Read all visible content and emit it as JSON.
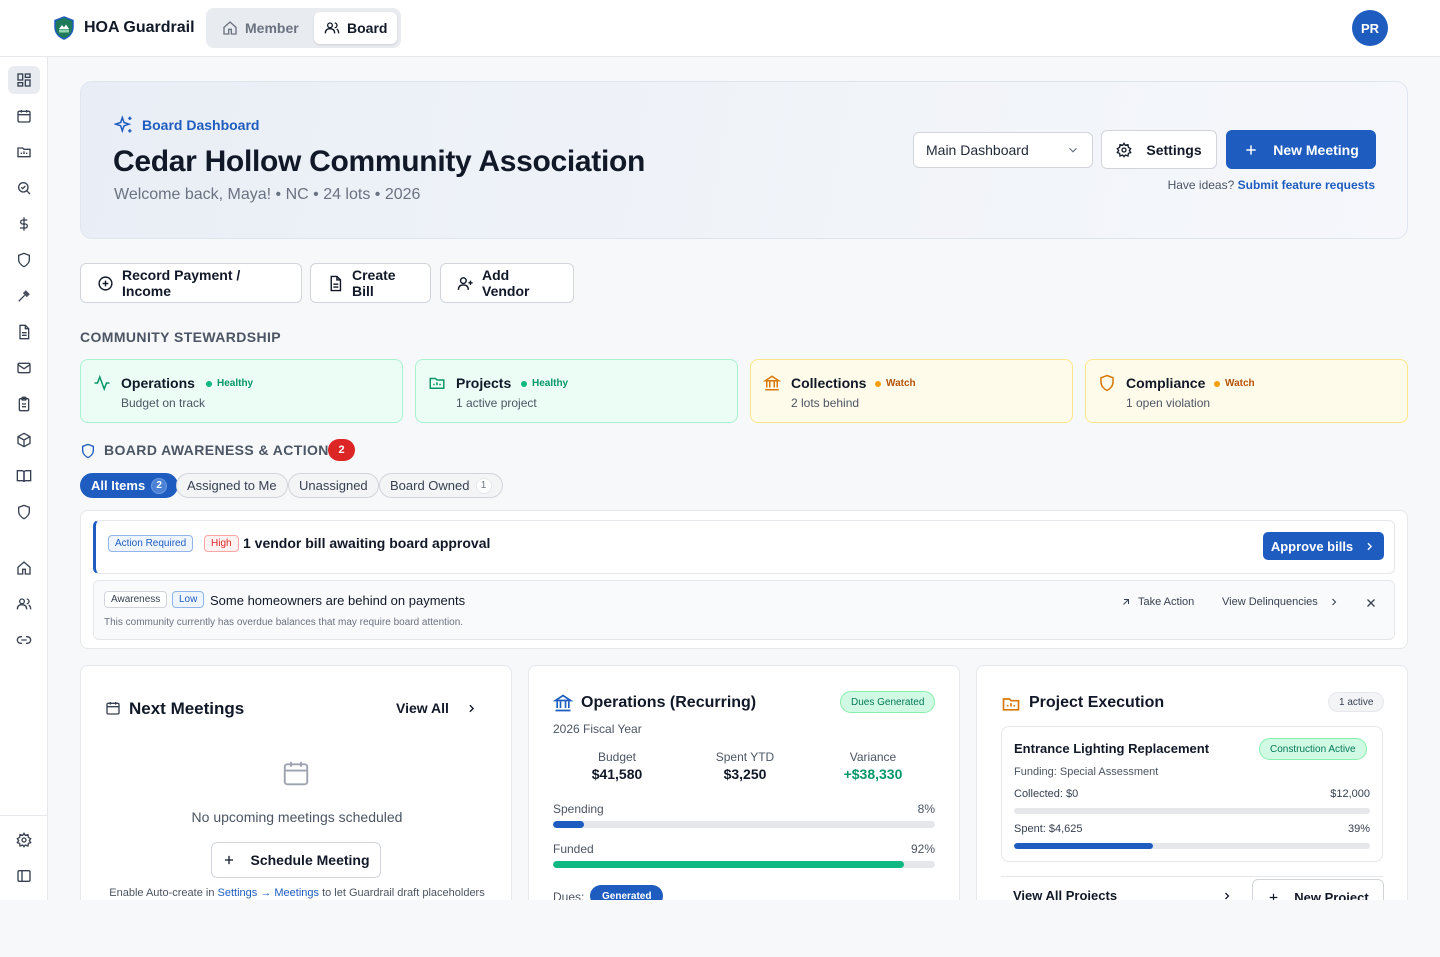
{
  "header": {
    "app_title": "HOA Guardrail",
    "modes": [
      {
        "label": "Member"
      },
      {
        "label": "Board"
      }
    ],
    "avatar_initials": "PR"
  },
  "hero": {
    "tag": "Board Dashboard",
    "title": "Cedar Hollow Community Association",
    "subtitle": "Welcome back, Maya! • NC • 24 lots • 2026",
    "dashboard_select": "Main Dashboard",
    "settings_label": "Settings",
    "new_meeting_label": "New Meeting",
    "ideas_text": "Have ideas?",
    "ideas_link": "Submit feature requests"
  },
  "quick_actions": [
    {
      "label": "Record Payment / Income"
    },
    {
      "label": "Create Bill"
    },
    {
      "label": "Add Vendor"
    }
  ],
  "stewardship": {
    "title": "COMMUNITY STEWARDSHIP",
    "cards": [
      {
        "title": "Operations",
        "status": "Healthy",
        "sub": "Budget on track"
      },
      {
        "title": "Projects",
        "status": "Healthy",
        "sub": "1 active project"
      },
      {
        "title": "Collections",
        "status": "Watch",
        "sub": "2 lots behind"
      },
      {
        "title": "Compliance",
        "status": "Watch",
        "sub": "1 open violation"
      }
    ]
  },
  "awareness": {
    "title": "BOARD AWARENESS & ACTIONS",
    "badge": "2",
    "filters": [
      {
        "label": "All Items",
        "count": "2"
      },
      {
        "label": "Assigned to Me",
        "count": ""
      },
      {
        "label": "Unassigned",
        "count": ""
      },
      {
        "label": "Board Owned",
        "count": "1"
      }
    ],
    "alert1": {
      "tag1": "Action Required",
      "tag2": "High",
      "title": "1 vendor bill awaiting board approval",
      "button": "Approve bills"
    },
    "alert2": {
      "tag1": "Awareness",
      "tag2": "Low",
      "title": "Some homeowners are behind on payments",
      "desc": "This community currently has overdue balances that may require board attention.",
      "take_action": "Take Action",
      "view_delinquencies": "View Delinquencies"
    }
  },
  "meetings": {
    "title": "Next Meetings",
    "view_all": "View All",
    "empty": "No upcoming meetings scheduled",
    "schedule_btn": "Schedule Meeting",
    "hint_prefix": "Enable Auto-create in",
    "hint_link1": "Settings",
    "hint_arrow": "→",
    "hint_link2": "Meetings",
    "hint_suffix": "to let Guardrail draft placeholders"
  },
  "operations": {
    "title": "Operations (Recurring)",
    "badge": "Dues Generated",
    "fiscal_year": "2026 Fiscal Year",
    "stats": [
      {
        "label": "Budget",
        "value": "$41,580"
      },
      {
        "label": "Spent YTD",
        "value": "$3,250"
      },
      {
        "label": "Variance",
        "value": "+$38,330"
      }
    ],
    "spending_label": "Spending",
    "spending_pct": "8%",
    "spending_value": 0.08,
    "funded_label": "Funded",
    "funded_pct": "92%",
    "funded_value": 0.92,
    "dues_label": "Dues:",
    "dues_status": "Generated"
  },
  "projects": {
    "title": "Project Execution",
    "badge": "1 active",
    "project": {
      "name": "Entrance Lighting Replacement",
      "status": "Construction Active",
      "funding": "Funding: Special Assessment",
      "collected_label": "Collected: $0",
      "collected_total": "$12,000",
      "collected_value": 0,
      "spent_label": "Spent: $4,625",
      "spent_pct": "39%",
      "spent_value": 0.39
    },
    "view_all": "View All Projects",
    "new_project": "New Project"
  },
  "colors": {
    "accent": "#1e5dbf",
    "healthy": "#059669",
    "watch": "#d97706",
    "danger": "#dc2626",
    "funded": "#10b981"
  },
  "icons": {
    "sidebar": [
      "dashboard-icon",
      "calendar-icon",
      "folder-icon",
      "search-icon",
      "dollar-icon",
      "shield-icon",
      "gavel-icon",
      "document-icon",
      "mail-icon",
      "clipboard-icon",
      "package-icon",
      "book-icon",
      "shield-icon",
      "home-icon",
      "users-icon",
      "link-icon",
      "gear-icon",
      "sidebar-toggle-icon"
    ]
  }
}
